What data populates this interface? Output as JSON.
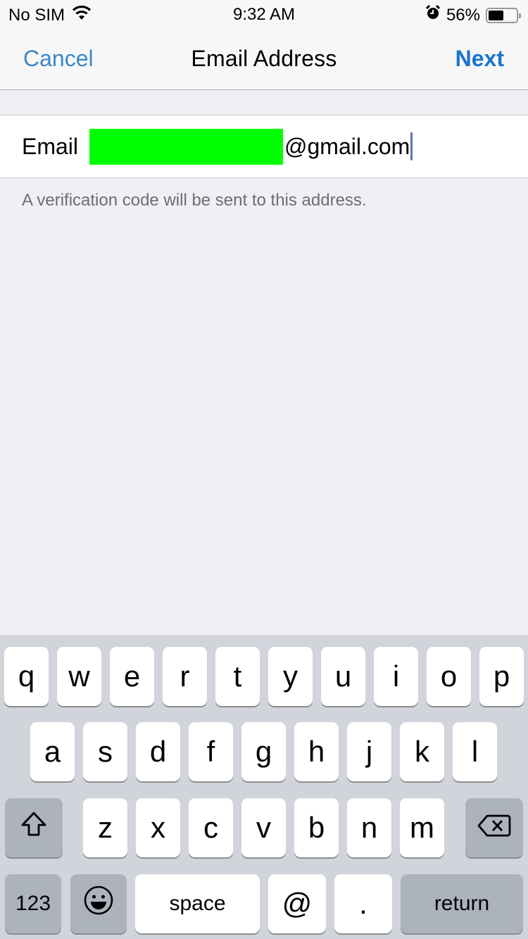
{
  "status_bar": {
    "carrier": "No SIM",
    "wifi_icon": "wifi-icon",
    "time": "9:32 AM",
    "alarm_icon": "alarm-clock-icon",
    "battery_percent": "56%",
    "battery_level": 0.56
  },
  "nav": {
    "cancel_label": "Cancel",
    "title": "Email Address",
    "next_label": "Next"
  },
  "form": {
    "email_label": "Email",
    "email_value_visible_suffix": "@gmail.com",
    "email_local_part": "[redacted]",
    "helper_text": "A verification code will be sent to this address."
  },
  "keyboard": {
    "row1": [
      "q",
      "w",
      "e",
      "r",
      "t",
      "y",
      "u",
      "i",
      "o",
      "p"
    ],
    "row2": [
      "a",
      "s",
      "d",
      "f",
      "g",
      "h",
      "j",
      "k",
      "l"
    ],
    "row3": [
      "z",
      "x",
      "c",
      "v",
      "b",
      "n",
      "m"
    ],
    "shift_icon": "shift-arrow-icon",
    "delete_icon": "backspace-icon",
    "numbers_label": "123",
    "emoji_icon": "emoji-smiley-icon",
    "space_label": "space",
    "at_label": "@",
    "dot_label": ".",
    "return_label": "return"
  },
  "colors": {
    "accent": "#1a74cf",
    "redaction": "#00ff00"
  }
}
